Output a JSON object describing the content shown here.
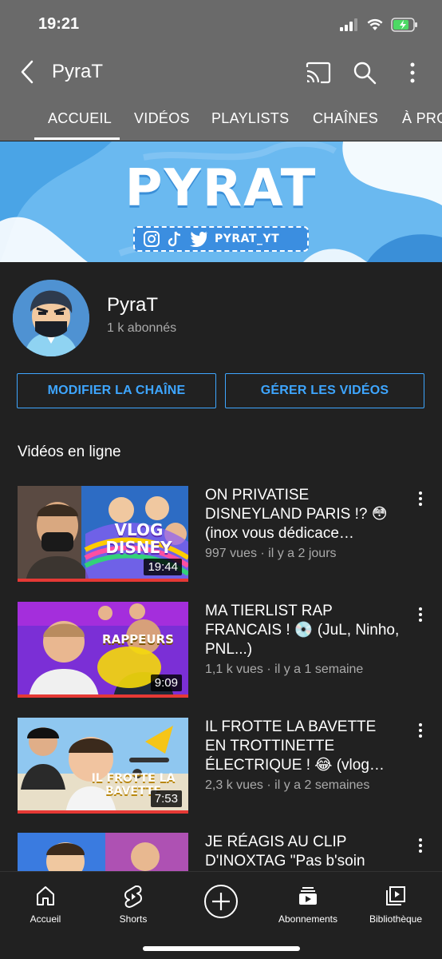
{
  "status_bar": {
    "time": "19:21"
  },
  "header": {
    "title": "PyraT",
    "tabs": [
      "ACCUEIL",
      "VIDÉOS",
      "PLAYLISTS",
      "CHAÎNES",
      "À PRO"
    ]
  },
  "banner": {
    "title": "PYRAT",
    "handle": "PYRAT_YT"
  },
  "channel": {
    "name": "PyraT",
    "subscribers": "1 k abonnés"
  },
  "actions": {
    "edit_label": "MODIFIER LA CHAÎNE",
    "manage_label": "GÉRER LES VIDÉOS"
  },
  "section": {
    "title": "Vidéos en ligne"
  },
  "videos": [
    {
      "title": "ON PRIVATISE DISNEYLAND PARIS !? 😳 (inox vous dédicace…",
      "meta": "997 vues · il y a 2 jours",
      "duration": "19:44",
      "thumb_text": "VLOG DISNEY"
    },
    {
      "title": "MA TIERLIST RAP FRANCAIS ! 💿 (JuL, Ninho, PNL...)",
      "meta": "1,1 k vues · il y a 1 semaine",
      "duration": "9:09",
      "thumb_text": "RAPPEURS"
    },
    {
      "title": "IL FROTTE LA BAVETTE EN TROTTINETTE ÉLECTRIQUE ! 😂 (vlog…",
      "meta": "2,3 k vues · il y a 2 semaines",
      "duration": "7:53",
      "thumb_text": "IL FROTTE LA BAVETTE"
    },
    {
      "title": "JE RÉAGIS AU CLIP D'INOXTAG \"Pas b'soin",
      "meta": "",
      "duration": "",
      "thumb_text": ""
    }
  ],
  "bottom_nav": [
    {
      "label": "Accueil",
      "icon": "home-icon"
    },
    {
      "label": "Shorts",
      "icon": "shorts-icon"
    },
    {
      "label": "",
      "icon": "create-icon"
    },
    {
      "label": "Abonnements",
      "icon": "subscriptions-icon"
    },
    {
      "label": "Bibliothèque",
      "icon": "library-icon"
    }
  ],
  "colors": {
    "accent": "#3ea6ff",
    "header_bg": "#6a6a6a",
    "bg": "#212121",
    "progress": "#e53935"
  }
}
